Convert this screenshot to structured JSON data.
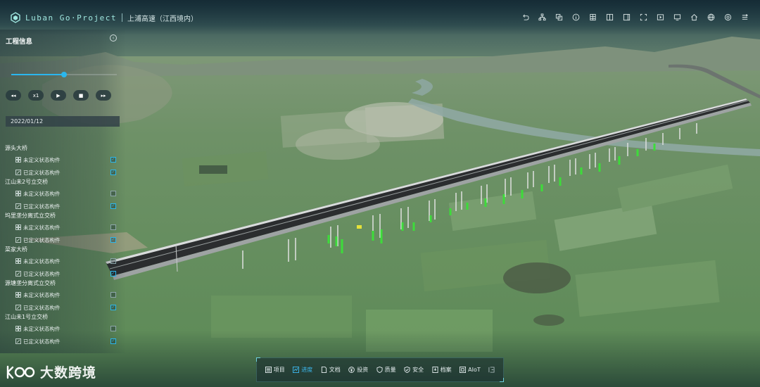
{
  "app": {
    "brand": "Luban Go·Project",
    "project": "上浦高速（江西境内）"
  },
  "toolbar": {
    "icons": [
      "undo-icon",
      "org-tree-icon",
      "copy-icon",
      "info-icon",
      "building-icon",
      "split-view-icon",
      "sidebar-icon",
      "fullscreen-icon",
      "video-icon",
      "monitor-icon",
      "home-icon",
      "globe-icon",
      "settings-icon",
      "layers-icon"
    ]
  },
  "panel": {
    "title": "工程信息",
    "progress": 0.5,
    "controls": {
      "rewind": "◂◂",
      "speed": "x1",
      "play": "▶",
      "stop": "■",
      "forward": "▸▸"
    },
    "date": "2022/01/12",
    "groups": [
      {
        "title": "源头大桥",
        "rows": [
          {
            "label": "未定义状态构件",
            "checked": true
          },
          {
            "label": "已定义状态构件",
            "checked": true
          }
        ]
      },
      {
        "title": "江山未2号立交桥",
        "rows": [
          {
            "label": "未定义状态构件",
            "checked": false
          },
          {
            "label": "已定义状态构件",
            "checked": true
          }
        ]
      },
      {
        "title": "坞里垄分离式立交桥",
        "rows": [
          {
            "label": "未定义状态构件",
            "checked": false
          },
          {
            "label": "已定义状态构件",
            "checked": true
          }
        ]
      },
      {
        "title": "菜家大桥",
        "rows": [
          {
            "label": "未定义状态构件",
            "checked": false
          },
          {
            "label": "已定义状态构件",
            "checked": true
          }
        ]
      },
      {
        "title": "源塘垄分离式立交桥",
        "rows": [
          {
            "label": "未定义状态构件",
            "checked": false
          },
          {
            "label": "已定义状态构件",
            "checked": true
          }
        ]
      },
      {
        "title": "江山未1号立交桥",
        "rows": [
          {
            "label": "未定义状态构件",
            "checked": false
          },
          {
            "label": "已定义状态构件",
            "checked": true
          }
        ]
      }
    ]
  },
  "bottom_nav": {
    "items": [
      {
        "label": "项目",
        "icon": "list-icon",
        "active": false
      },
      {
        "label": "进度",
        "icon": "progress-icon",
        "active": true
      },
      {
        "label": "文档",
        "icon": "document-icon",
        "active": false
      },
      {
        "label": "投资",
        "icon": "yen-icon",
        "active": false
      },
      {
        "label": "质量",
        "icon": "shield-icon",
        "active": false
      },
      {
        "label": "安全",
        "icon": "shield-check-icon",
        "active": false
      },
      {
        "label": "档案",
        "icon": "archive-icon",
        "active": false
      },
      {
        "label": "AIoT",
        "icon": "chip-icon",
        "active": false
      }
    ],
    "extra_icon": "expand-icon"
  },
  "watermark": {
    "text": "大数跨境"
  },
  "colors": {
    "accent": "#2ab7ee",
    "brand": "#9fe6df",
    "pier_green": "#3ddc3a"
  }
}
